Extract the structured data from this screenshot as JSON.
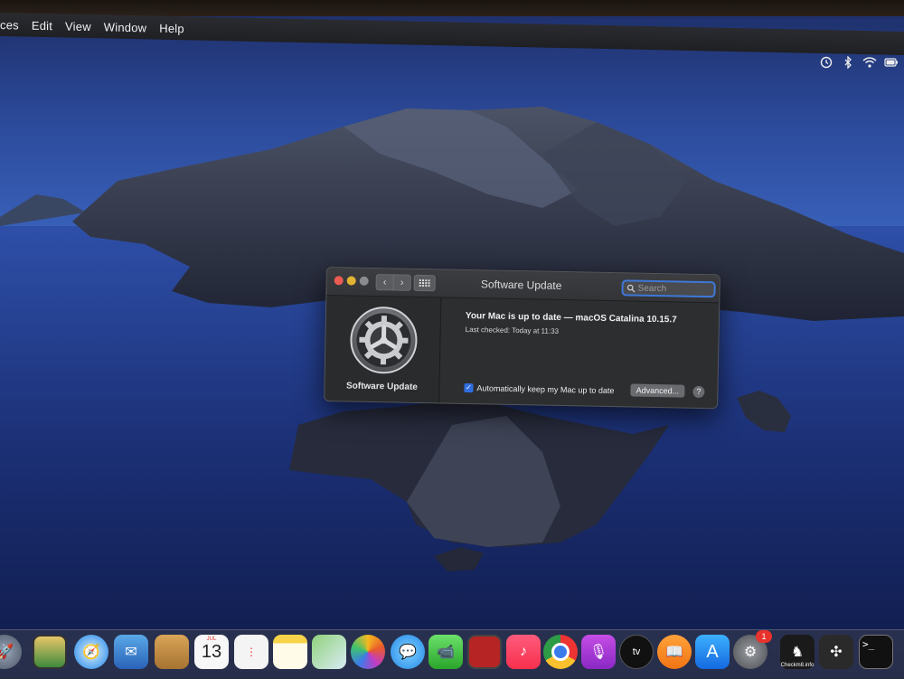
{
  "menubar": {
    "items": [
      "ces",
      "Edit",
      "View",
      "Window",
      "Help"
    ]
  },
  "status_icons": [
    "time-machine-icon",
    "bluetooth-icon",
    "wifi-icon",
    "battery-icon"
  ],
  "window": {
    "title": "Software Update",
    "search_placeholder": "Search",
    "pane_label": "Software Update",
    "status_title": "Your Mac is up to date — macOS Catalina 10.15.7",
    "last_checked": "Last checked: Today at 11:33",
    "auto_update_label": "Automatically keep my Mac up to date",
    "auto_update_checked": true,
    "advanced_label": "Advanced...",
    "help_label": "?"
  },
  "dock": {
    "calendar_month": "JUL",
    "calendar_day": "13",
    "system_preferences_badge": "1",
    "checkm8_label": "Checkm8.info",
    "appletv_label": "tv",
    "items": [
      "launchpad",
      "photo-slideshow",
      "safari",
      "mail",
      "contacts",
      "calendar",
      "reminders",
      "notes",
      "maps",
      "photos",
      "messages",
      "facetime",
      "photo-booth",
      "music",
      "chrome",
      "podcasts",
      "apple-tv",
      "books",
      "app-store",
      "system-preferences",
      "checkm8",
      "tool-app",
      "terminal"
    ]
  },
  "colors": {
    "accent": "#2f6ee0",
    "window_bg": "#2d2e30",
    "close": "#ec5b52",
    "minimize": "#e2b232"
  }
}
